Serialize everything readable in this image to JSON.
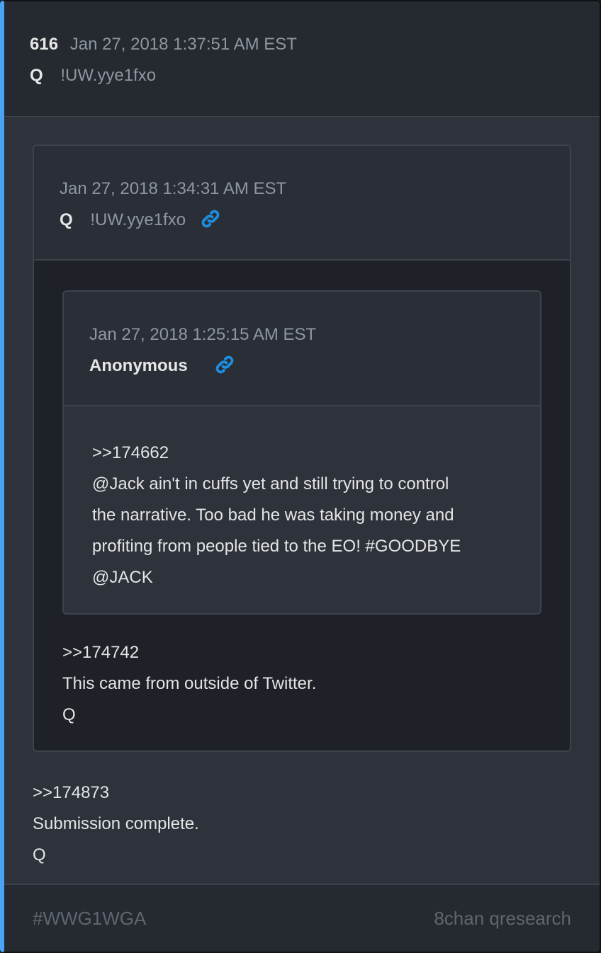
{
  "post": {
    "number": "616",
    "datetime": "Jan 27, 2018 1:37:51 AM EST",
    "author": "Q",
    "tripcode": "!UW.yye1fxo",
    "lines": [
      ">>174873",
      "Submission complete.",
      "Q"
    ]
  },
  "quote_outer": {
    "datetime": "Jan 27, 2018 1:34:31 AM EST",
    "author": "Q",
    "tripcode": "!UW.yye1fxo",
    "link_icon": "link-icon",
    "lines": [
      ">>174742",
      "This came from outside of Twitter.",
      "Q"
    ]
  },
  "quote_inner": {
    "datetime": "Jan 27, 2018 1:25:15 AM EST",
    "author": "Anonymous",
    "link_icon": "link-icon",
    "lines": [
      ">>174662",
      "@Jack ain't in cuffs yet and still trying to control",
      "the narrative. Too bad he was taking money and",
      "profiting from people tied to the EO! #GOODBYE",
      "@JACK"
    ]
  },
  "footer": {
    "hashtag": "#WWG1WGA",
    "source": "8chan qresearch"
  },
  "colors": {
    "accent": "#4ba3f5",
    "link": "#1b8fe0"
  }
}
